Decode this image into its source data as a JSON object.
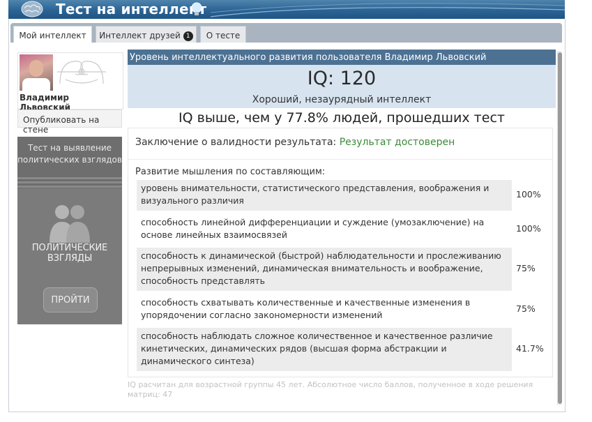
{
  "app": {
    "title": "Тест на интеллект"
  },
  "tabs": [
    {
      "label": "Мой интеллект",
      "active": true
    },
    {
      "label": "Интеллект друзей",
      "badge": "1"
    },
    {
      "label": "О тесте"
    }
  ],
  "profile": {
    "name": "Владимир Львовский",
    "publish_label": "Опубликовать на стене"
  },
  "ad": {
    "top_text": "Тест на выявление политических взглядов",
    "label": "ПОЛИТИЧЕСКИЕ ВЗГЛЯДЫ",
    "button_label": "ПРОЙТИ"
  },
  "result": {
    "header": "Уровень интеллектуального развития пользователя Владимир Львовский",
    "iq": "IQ: 120",
    "iq_description": "Хороший, незаурядный интеллект",
    "percent_text": "IQ выше, чем у 77.8% людей, прошедших тест",
    "validity_label": "Заключение о валидности результата:",
    "validity_value": "Результат достоверен",
    "development_title": "Развитие мышления по составляющим:",
    "components": [
      {
        "text": "уровень внимательности, статистического представления, воображения и визуального различия",
        "value": "100%"
      },
      {
        "text": "способность линейной дифференциации и суждение (умозаключение) на основе линейных взаимосвязей",
        "value": "100%"
      },
      {
        "text": "способность к динамической (быстрой) наблюдательности и прослеживанию непрерывных изменений, динамическая внимательность и воображение, способность представлять",
        "value": "75%"
      },
      {
        "text": "способность схватывать количественные и качественные изменения в упорядочении согласно закономерности изменений",
        "value": "75%"
      },
      {
        "text": "способность наблюдать сложное количественное и качественное различие кинетических, динамических рядов (высшая форма абстракции и динамического синтеза)",
        "value": "41.7%"
      }
    ],
    "note": "IQ расчитан для возрастной группы 45 лет. Абсолютное число баллов, полученное в ходе решения матриц: 47"
  },
  "colors": {
    "header": "#2b6394",
    "result_head": "#4d7193",
    "iq_box": "#d7e4f0",
    "valid": "#3a8a3a"
  }
}
